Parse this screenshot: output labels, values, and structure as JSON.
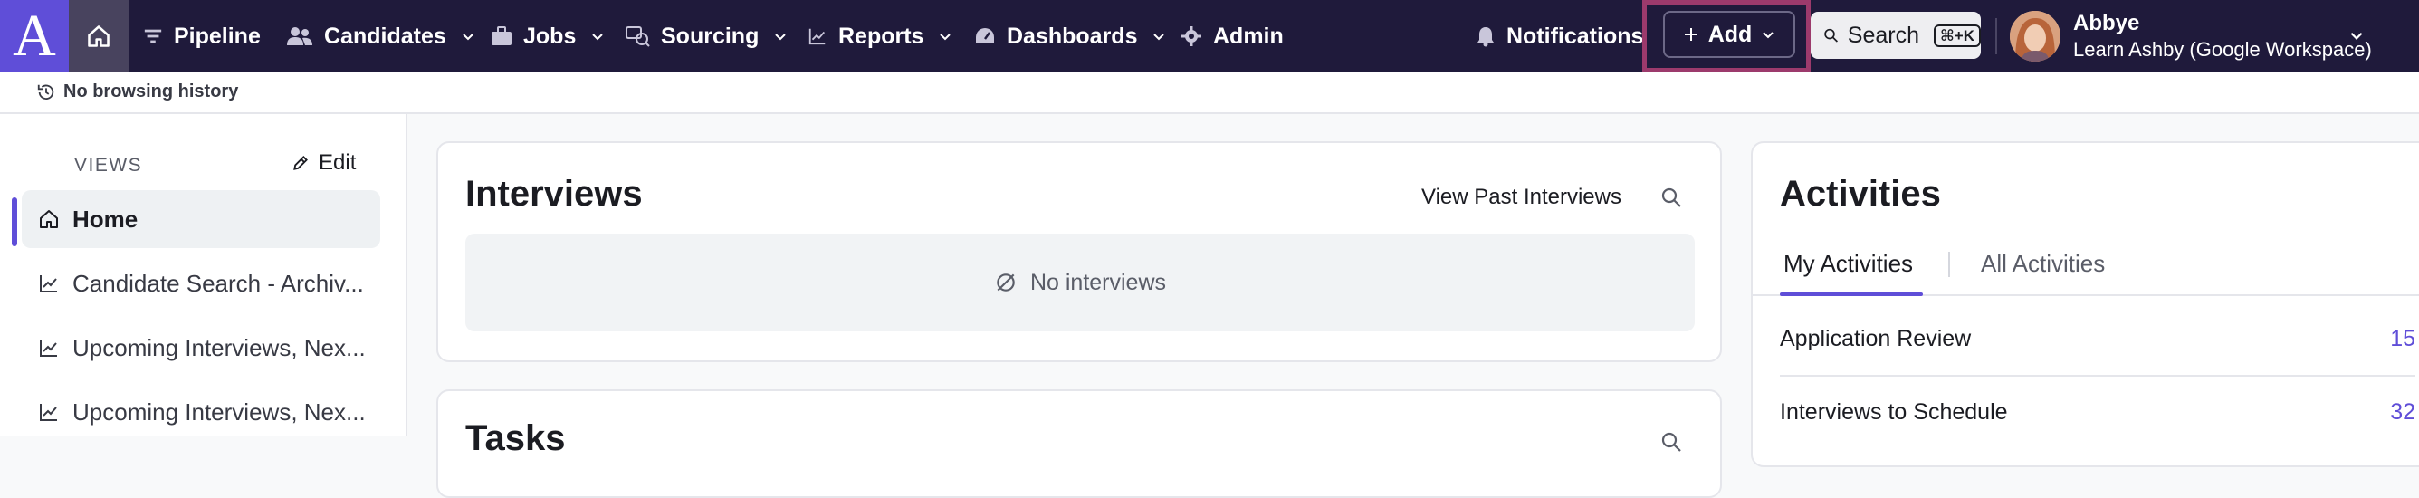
{
  "nav": {
    "logo_letter": "A",
    "items": [
      {
        "label": "Pipeline"
      },
      {
        "label": "Candidates"
      },
      {
        "label": "Jobs"
      },
      {
        "label": "Sourcing"
      },
      {
        "label": "Reports"
      },
      {
        "label": "Dashboards"
      },
      {
        "label": "Admin"
      }
    ],
    "notifications_label": "Notifications",
    "add_label": "Add",
    "search_label": "Search",
    "search_shortcut": "⌘+K",
    "user_name": "Abbye",
    "user_org": "Learn Ashby (Google Workspace)",
    "accent_color": "#5f4ed8",
    "highlight_color": "#9c3a6c"
  },
  "history": {
    "label": "No browsing history"
  },
  "sidebar": {
    "views_label": "VIEWS",
    "edit_label": "Edit",
    "items": [
      {
        "label": "Home",
        "icon": "home-icon"
      },
      {
        "label": "Candidate Search - Archiv...",
        "icon": "chart-line-icon"
      },
      {
        "label": "Upcoming Interviews, Nex...",
        "icon": "chart-line-icon"
      },
      {
        "label": "Upcoming Interviews, Nex...",
        "icon": "chart-line-icon"
      }
    ]
  },
  "interviews": {
    "title": "Interviews",
    "view_past_label": "View Past Interviews",
    "empty_label": "No interviews"
  },
  "tasks": {
    "title": "Tasks"
  },
  "activities": {
    "title": "Activities",
    "tabs": [
      {
        "label": "My Activities"
      },
      {
        "label": "All Activities"
      }
    ],
    "rows": [
      {
        "label": "Application Review",
        "count": "15"
      },
      {
        "label": "Interviews to Schedule",
        "count": "32"
      }
    ]
  }
}
